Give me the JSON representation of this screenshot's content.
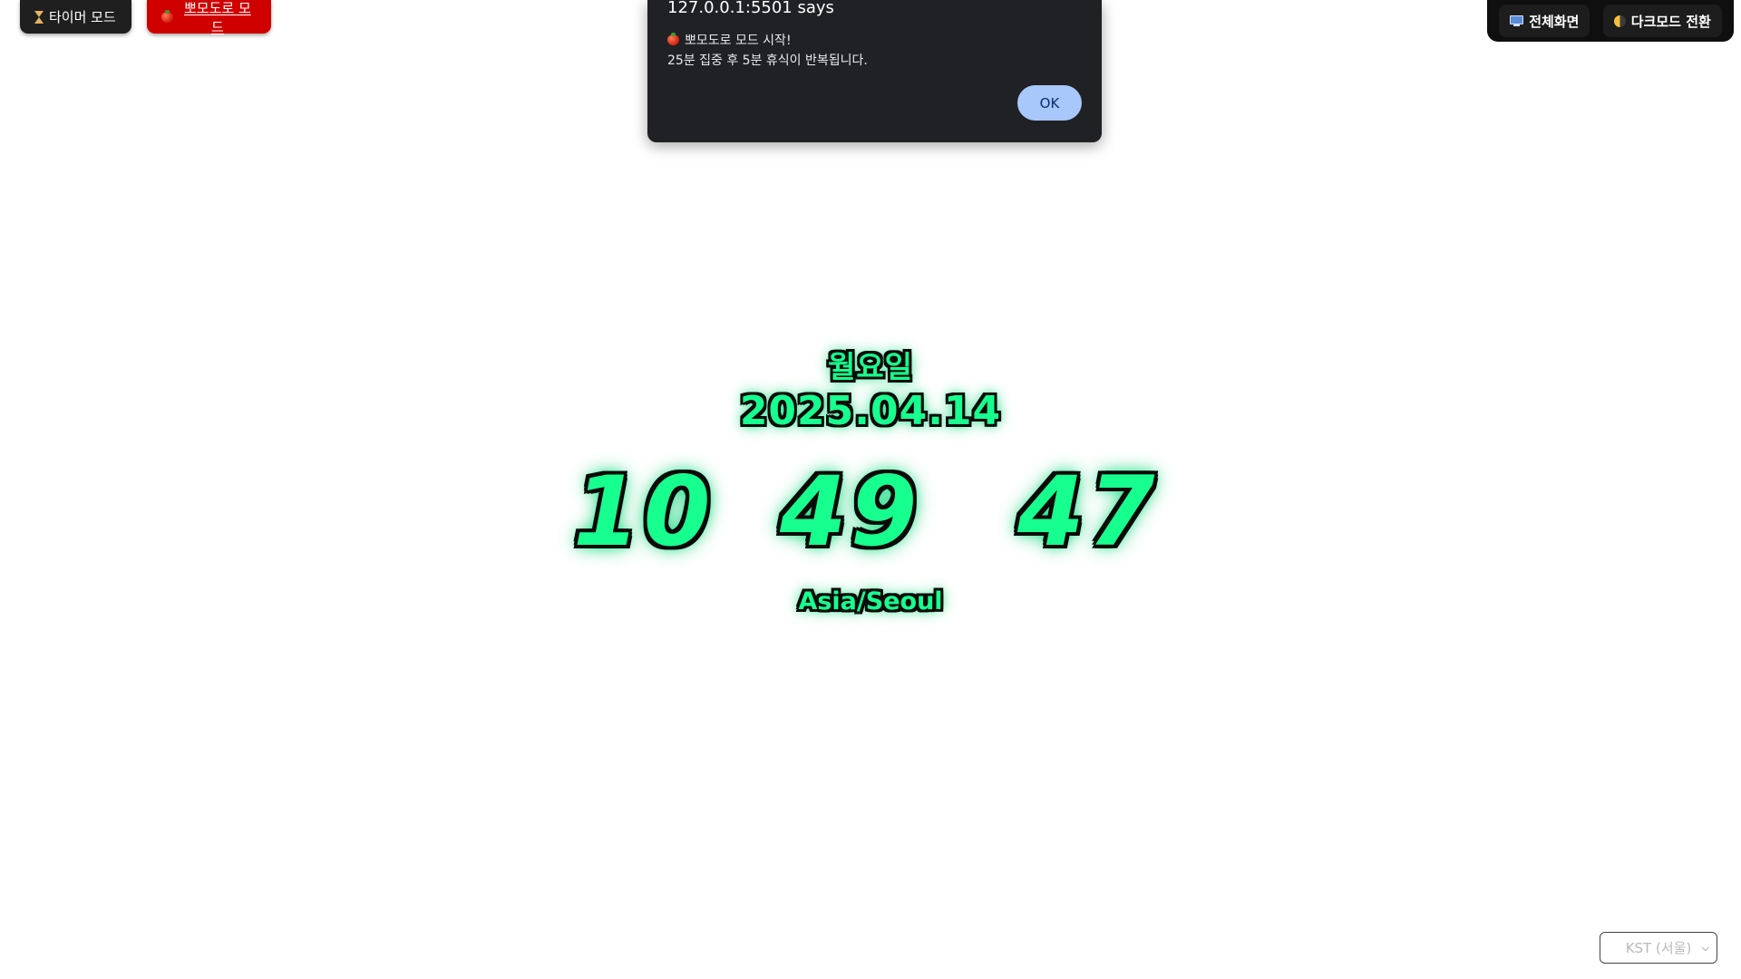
{
  "modes": {
    "timer_label": "타이머 모드",
    "pomodoro_label": "뽀모도로 모드"
  },
  "controls": {
    "fullscreen_label": "전체화면",
    "darkmode_label": "다크모드 전환"
  },
  "dialog": {
    "title": "127.0.0.1:5501 says",
    "line1": "뽀모도로 모드 시작!",
    "line2": "25분 집중 후 5분 휴식이 반복됩니다.",
    "ok_label": "OK"
  },
  "clock": {
    "weekday": "월요일",
    "date": "2025.04.14",
    "hours": "10",
    "minutes": "49",
    "seconds": "47",
    "timezone": "Asia/Seoul"
  },
  "timezone_select": {
    "selected": "KST (서울)"
  },
  "colors": {
    "neon_green": "#17ff8e",
    "pomodoro_red": "#d00000",
    "dialog_bg": "#202124",
    "ok_button": "#a8c7fa"
  },
  "icons": [
    "hourglass-icon",
    "tomato-icon",
    "monitor-icon",
    "half-moon-icon"
  ]
}
